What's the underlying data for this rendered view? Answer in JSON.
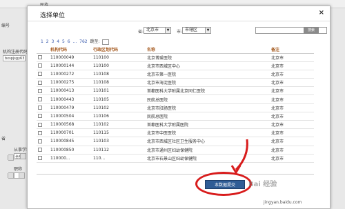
{
  "background": {
    "top_label": "民族",
    "left_label_1": "编号",
    "left_label_2": "机构注册代码",
    "left_input_value": "bxspjsgy63",
    "left_label_3": "省",
    "left_label_4": "从事学科",
    "left_select_value": "全部",
    "left_label_5": "职称"
  },
  "dialog": {
    "title": "选择单位",
    "close_symbol": "×",
    "filters": {
      "province_label": "省:",
      "province_value": "北京市",
      "city_label": "市:",
      "city_value": "市辖区",
      "search_button": "搜索"
    },
    "pager": {
      "pages": [
        "1",
        "2",
        "3",
        "4",
        "5",
        "6",
        "...",
        "762"
      ],
      "jump_label": "跳至:"
    },
    "columns": [
      "机构代码",
      "行政区划代码",
      "名称",
      "备注"
    ],
    "rows": [
      {
        "code": "110000049",
        "region": "110100",
        "name": "北京博爱医院",
        "note": "北京市"
      },
      {
        "code": "110000144",
        "region": "110100",
        "name": "北京市西城区中心",
        "note": "北京市"
      },
      {
        "code": "110000272",
        "region": "110108",
        "name": "北京市第一医院",
        "note": "北京市"
      },
      {
        "code": "110000275",
        "region": "110108",
        "name": "北京市海淀医院",
        "note": "北京市"
      },
      {
        "code": "110000413",
        "region": "110101",
        "name": "首都医科大学附属北京同仁医院",
        "note": "北京市"
      },
      {
        "code": "110000443",
        "region": "110105",
        "name": "民航总医院",
        "note": "北京市"
      },
      {
        "code": "110000479",
        "region": "110102",
        "name": "北京市肛肠医院",
        "note": "北京市"
      },
      {
        "code": "110000504",
        "region": "110106",
        "name": "民航总医院",
        "note": "北京市"
      },
      {
        "code": "110000568",
        "region": "110102",
        "name": "首都医科大学附属医院",
        "note": "北京市"
      },
      {
        "code": "110000701",
        "region": "110115",
        "name": "北京市中医医院",
        "note": "北京市"
      },
      {
        "code": "110000845",
        "region": "110103",
        "name": "北京市西城区社区卫生服务中心",
        "note": "北京市"
      },
      {
        "code": "110000850",
        "region": "110112",
        "name": "北京市通州区妇幼保健院",
        "note": "北京市"
      },
      {
        "code": "110000...",
        "region": "110...",
        "name": "北京市石景山区妇幼保健院",
        "note": "北京市"
      }
    ],
    "confirm_button": "本数据提交"
  },
  "watermark": {
    "text": "Bai 经验",
    "url": "jingyan.baidu.com"
  },
  "colors": {
    "header_text": "#a55a1f",
    "confirm_button": "#2f5d96",
    "annotation": "#d81c1c"
  }
}
